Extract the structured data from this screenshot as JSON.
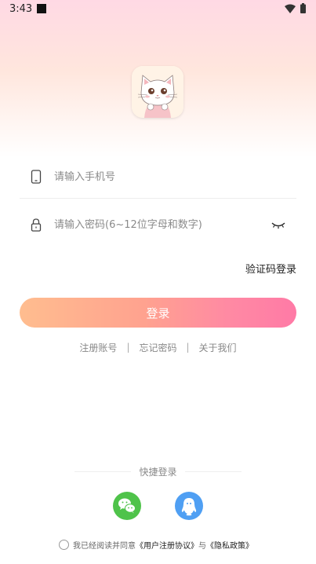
{
  "status_bar": {
    "time": "3:43"
  },
  "form": {
    "phone_placeholder": "请输入手机号",
    "password_placeholder": "请输入密码(6~12位字母和数字)",
    "code_login_label": "验证码登录",
    "login_button": "登录"
  },
  "links": {
    "register": "注册账号",
    "separator": "|",
    "forgot": "忘记密码",
    "about": "关于我们"
  },
  "quick_login": {
    "title": "快捷登录"
  },
  "agreement": {
    "prefix": "我已经阅读并同意",
    "user_agreement": "《用户注册协议》",
    "conj": "与",
    "privacy": "《隐私政策》"
  },
  "colors": {
    "accent_start": "#ffbd8f",
    "accent_end": "#ff7aa6",
    "wechat": "#4fc34a",
    "qq": "#4f9ff3"
  },
  "icons": [
    "phone-icon",
    "lock-icon",
    "eye-closed-icon",
    "wechat-icon",
    "qq-icon",
    "wifi-icon",
    "battery-icon"
  ]
}
